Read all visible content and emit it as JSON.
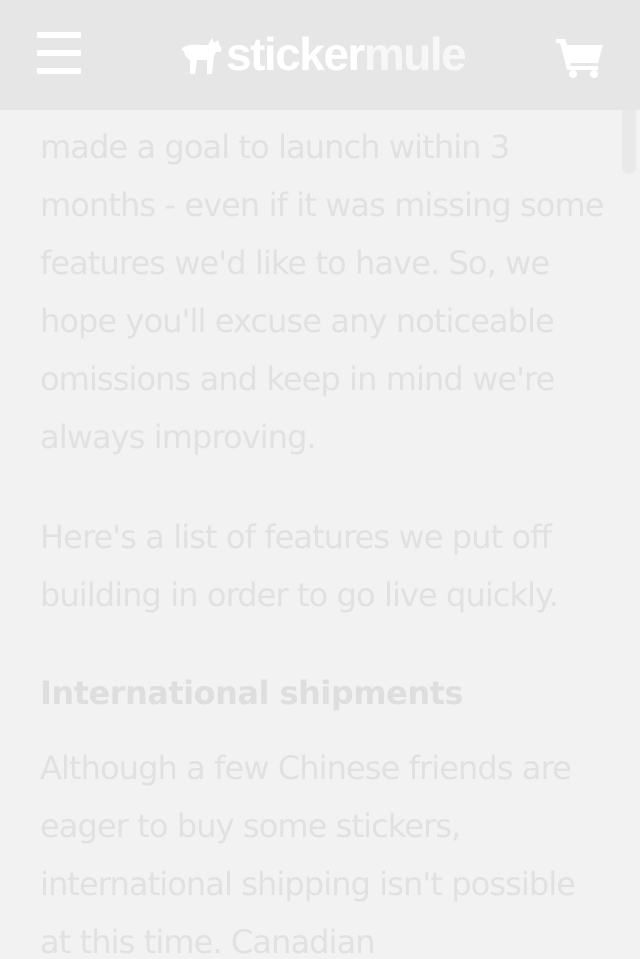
{
  "header": {
    "logo_part1": "sticker",
    "logo_part2": "mule",
    "menu_icon": "hamburger-menu-icon",
    "cart_icon": "shopping-cart-icon",
    "bar_color": "#e6e6e6"
  },
  "article": {
    "paragraph1": "made a goal to launch within 3 months - even if it was missing some features we'd like to have. So, we hope you'll excuse any noticeable omissions and keep in mind we're always improving.",
    "paragraph2": "Here's a list of features we put off building in order to go live quickly.",
    "heading": "International shipments",
    "paragraph3": "Although a few Chinese friends are eager to buy some stickers, international shipping isn't possible at this time. Canadian"
  }
}
